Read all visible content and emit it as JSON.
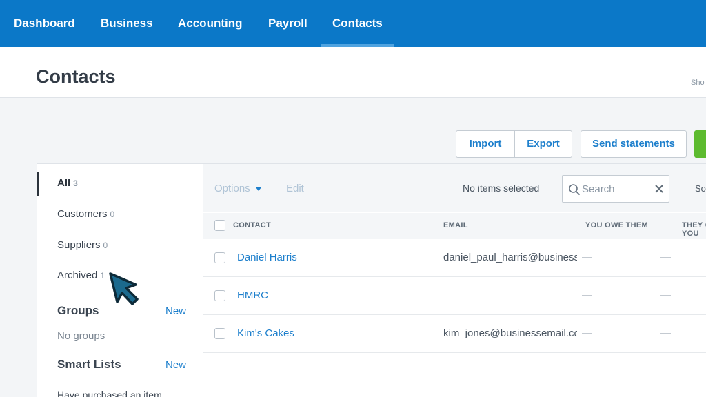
{
  "nav": {
    "items": [
      "Dashboard",
      "Business",
      "Accounting",
      "Payroll",
      "Contacts"
    ],
    "active": "Contacts"
  },
  "page": {
    "title": "Contacts",
    "show_link": "Sho"
  },
  "actions": {
    "import": "Import",
    "export": "Export",
    "send_statements": "Send statements"
  },
  "filters": [
    {
      "label": "All",
      "count": "3"
    },
    {
      "label": "Customers",
      "count": "0"
    },
    {
      "label": "Suppliers",
      "count": "0"
    },
    {
      "label": "Archived",
      "count": "1"
    }
  ],
  "groups": {
    "heading": "Groups",
    "new_label": "New",
    "empty": "No groups"
  },
  "smart_lists": {
    "heading": "Smart Lists",
    "new_label": "New",
    "item": "Have purchased an item"
  },
  "toolbar": {
    "options": "Options",
    "edit": "Edit",
    "selection": "No items selected",
    "search_placeholder": "Search",
    "sort": "So"
  },
  "table": {
    "columns": [
      "CONTACT",
      "EMAIL",
      "YOU OWE THEM",
      "THEY OWE YOU"
    ],
    "rows": [
      {
        "name": "Daniel Harris",
        "email": "daniel_paul_harris@business",
        "owe_them": "—",
        "they_owe": "—"
      },
      {
        "name": "HMRC",
        "email": "",
        "owe_them": "—",
        "they_owe": "—"
      },
      {
        "name": "Kim's Cakes",
        "email": "kim_jones@businessemail.com",
        "owe_them": "—",
        "they_owe": "—"
      }
    ]
  },
  "colors": {
    "nav_bg": "#0b78c8",
    "link": "#1d7fcc",
    "primary_green": "#5dbb2f",
    "cursor": "#1b6a8e"
  }
}
